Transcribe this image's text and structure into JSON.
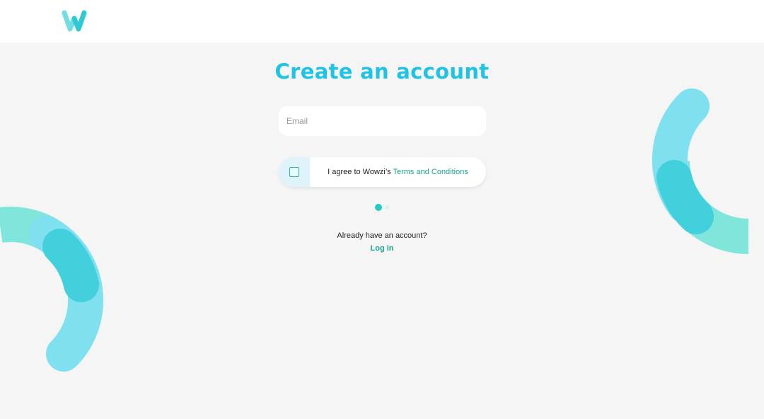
{
  "header": {
    "logo_icon": "wowzi-w-logo"
  },
  "main": {
    "title": "Create an account",
    "email": {
      "placeholder": "Email",
      "value": ""
    },
    "terms": {
      "checked": false,
      "prefix": "I agree to Wowzi’s ",
      "link": "Terms and Conditions"
    },
    "pagination": {
      "current": 1,
      "total": 2
    },
    "already_text": "Already have an account?",
    "login_label": "Log in"
  },
  "colors": {
    "accent": "#1ec3e6",
    "link": "#1aa58f",
    "teal": "#22ccc4",
    "light_blue": "#7fe0f0",
    "mint": "#80e6dc",
    "background": "#f5f5f5"
  }
}
